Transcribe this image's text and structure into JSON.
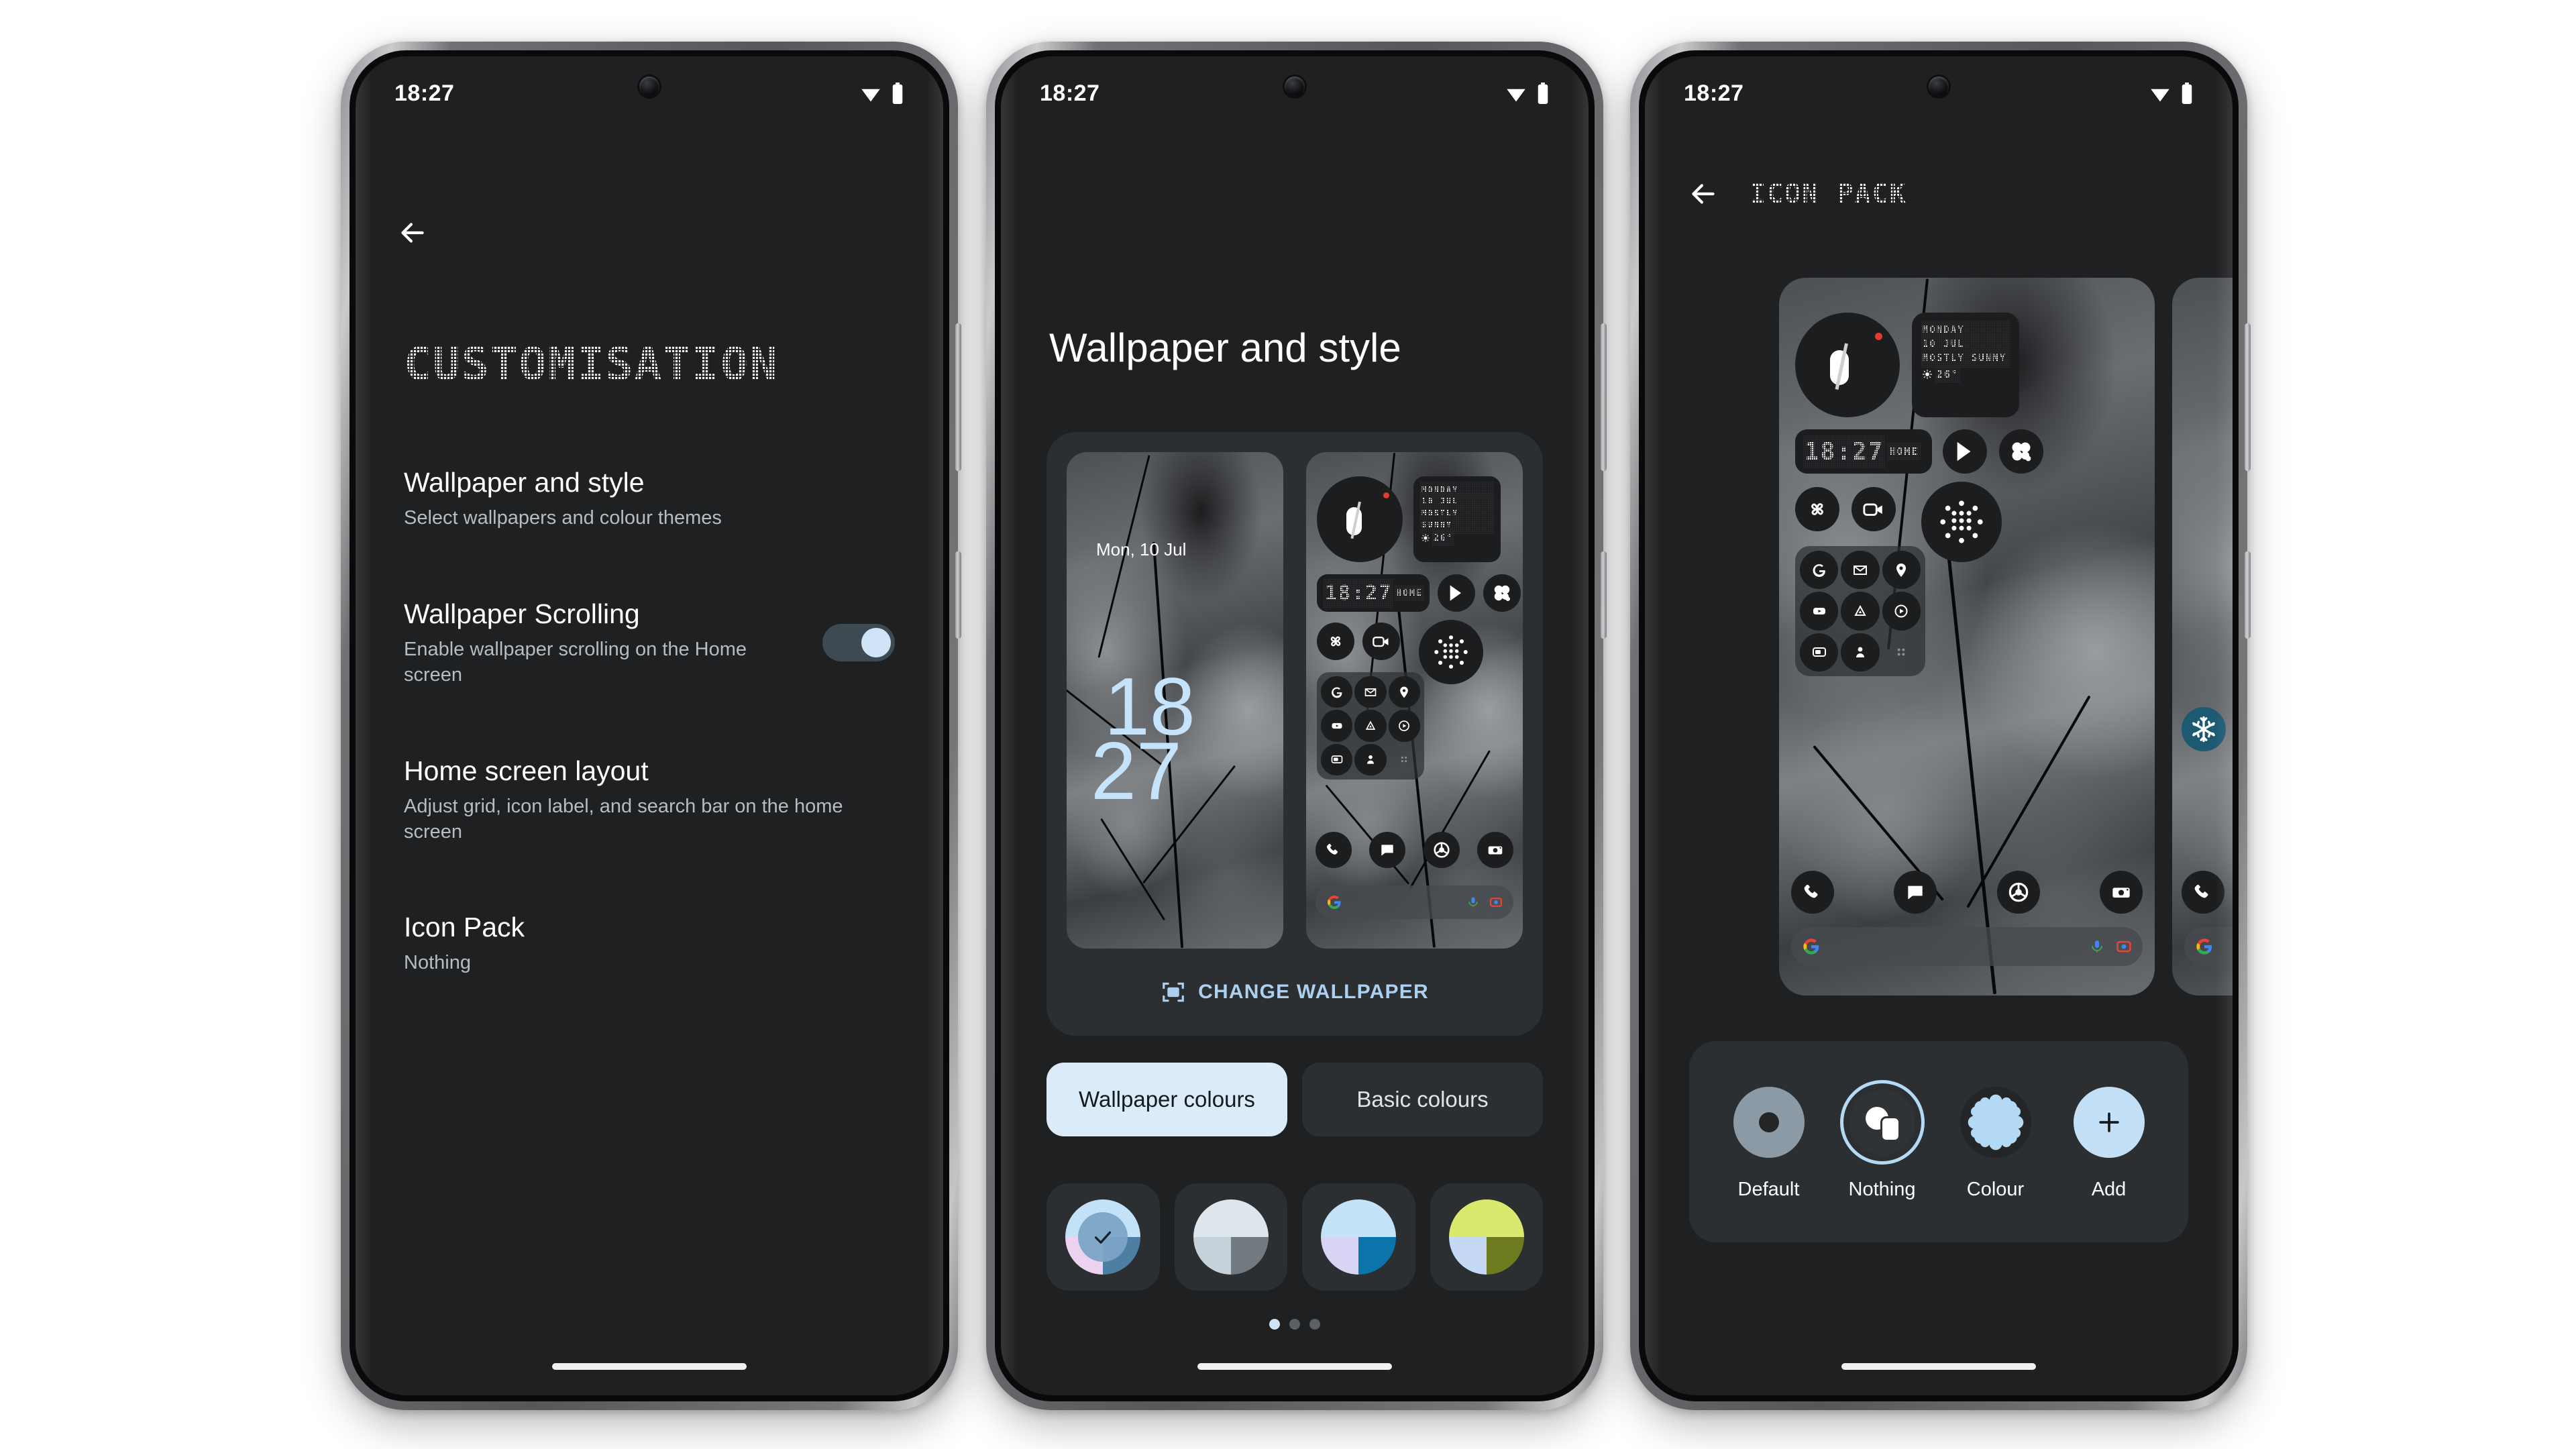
{
  "phones": [
    {
      "id": "phone-customisation",
      "statusbar": {
        "time": "18:27",
        "wifi_icon": "wifi-icon",
        "battery_icon": "battery-icon"
      },
      "back_icon": "back-arrow-icon",
      "page_title": "CUSTOMISATION",
      "settings": [
        {
          "title": "Wallpaper and style",
          "subtitle": "Select wallpapers and colour themes",
          "control": "none"
        },
        {
          "title": "Wallpaper Scrolling",
          "subtitle": "Enable wallpaper scrolling on the Home screen",
          "control": "toggle",
          "toggle_on": true
        },
        {
          "title": "Home screen layout",
          "subtitle": "Adjust grid, icon label, and search bar on the home screen",
          "control": "none"
        },
        {
          "title": "Icon Pack",
          "subtitle": "Nothing",
          "control": "none"
        }
      ]
    },
    {
      "id": "phone-wallpaper-style",
      "statusbar": {
        "time": "18:27",
        "wifi_icon": "wifi-icon",
        "battery_icon": "battery-icon"
      },
      "page_title": "Wallpaper and style",
      "change_wallpaper": {
        "label": "CHANGE WALLPAPER",
        "icon": "image-frame-icon"
      },
      "tabs": [
        {
          "label": "Wallpaper colours",
          "active": true
        },
        {
          "label": "Basic colours",
          "active": false
        }
      ],
      "swatches": [
        {
          "name": "swatch-1",
          "selected": true,
          "colors": [
            "#c4e2f7",
            "#c4e2f7",
            "#edd3ef",
            "#4d7fa3"
          ]
        },
        {
          "name": "swatch-2",
          "selected": false,
          "colors": [
            "#dde6ec",
            "#dde6ec",
            "#c6d2d9",
            "#727a81"
          ]
        },
        {
          "name": "swatch-3",
          "selected": false,
          "colors": [
            "#c3e3f9",
            "#c3e3f9",
            "#d7d4f4",
            "#0b74ab"
          ]
        },
        {
          "name": "swatch-4",
          "selected": false,
          "colors": [
            "#dbe86e",
            "#dbe86e",
            "#c5d9f5",
            "#6e7a1f"
          ]
        }
      ],
      "page_dots": {
        "count": 3,
        "active_index": 0
      },
      "lock_preview": {
        "date": "Mon, 10 Jul",
        "clock_top": "18",
        "clock_bottom": "27"
      },
      "home_preview": {
        "weather_widget": {
          "day": "MONDAY",
          "date": "10 JUL",
          "condition": "MOSTLY SUNNY",
          "temp": "26°",
          "icon": "sun-icon"
        },
        "clock_widget": {
          "time": "18:27",
          "label": "HOME"
        },
        "analog_clock_icon": "analog-clock-widget",
        "icons": [
          "play-store-icon",
          "glyph-flower-icon",
          "pinwheel-icon",
          "video-camera-icon",
          "nothing-dots-icon",
          "google-icon",
          "gmail-icon",
          "maps-icon",
          "youtube-icon",
          "drive-icon",
          "youtube-music-icon",
          "gallery-icon",
          "contacts-icon",
          "app-drawer-icon"
        ],
        "dock": [
          "phone-icon",
          "messages-icon",
          "chrome-icon",
          "camera-icon"
        ],
        "search_bar": {
          "leading_icon": "google-g-icon",
          "mic_icon": "mic-icon",
          "lens_icon": "lens-icon"
        }
      }
    },
    {
      "id": "phone-icon-pack",
      "statusbar": {
        "time": "18:27",
        "wifi_icon": "wifi-icon",
        "battery_icon": "battery-icon"
      },
      "back_icon": "back-arrow-icon",
      "page_title": "ICON PACK",
      "home_preview": {
        "weather_widget": {
          "day": "MONDAY",
          "date": "10 JUL",
          "condition": "MOSTLY SUNNY",
          "temp": "26°",
          "icon": "sun-icon"
        },
        "clock_widget": {
          "time": "18:27",
          "label": "HOME"
        },
        "dock": [
          "phone-icon",
          "messages-icon",
          "chrome-icon",
          "camera-icon"
        ],
        "search_bar": {
          "leading_icon": "google-g-icon",
          "mic_icon": "mic-icon",
          "lens_icon": "lens-icon"
        }
      },
      "second_page_preview": {
        "icons": [
          "snowflake-icon",
          "flame-icon",
          "phone-icon",
          "messages-icon"
        ]
      },
      "icon_packs": [
        {
          "label": "Default",
          "selected": false,
          "icon": "default-dot-icon"
        },
        {
          "label": "Nothing",
          "selected": true,
          "icon": "nothing-shapes-icon"
        },
        {
          "label": "Colour",
          "selected": false,
          "icon": "scalloped-blob-icon"
        },
        {
          "label": "Add",
          "selected": false,
          "icon": "plus-icon"
        }
      ]
    }
  ],
  "colors": {
    "accent_light_blue": "#cfe5f7",
    "tab_active_bg": "#dcebf9",
    "card_bg": "#2c2f31",
    "screen_bg": "#1e2022",
    "toggle_track": "#3d4a52",
    "link_blue": "#aed0f0",
    "notif_red": "#e03c31"
  }
}
